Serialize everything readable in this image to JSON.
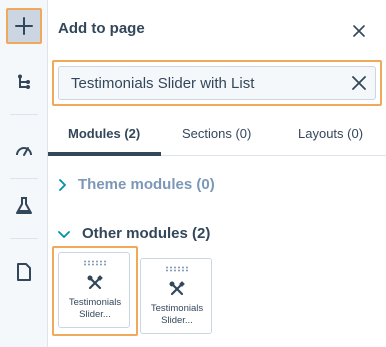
{
  "rail": {
    "icons": [
      "plus-icon",
      "tree-icon",
      "gauge-icon",
      "flask-icon",
      "document-icon"
    ]
  },
  "panel": {
    "title": "Add to page",
    "search": {
      "value": "Testimonials Slider with List"
    },
    "tabs": [
      {
        "label": "Modules (2)",
        "active": true
      },
      {
        "label": "Sections (0)",
        "active": false
      },
      {
        "label": "Layouts (0)",
        "active": false
      }
    ],
    "groups": [
      {
        "label": "Theme modules (0)",
        "expanded": false
      },
      {
        "label": "Other modules (2)",
        "expanded": true
      }
    ],
    "modules": [
      {
        "label_line1": "Testimonials",
        "label_line2": "Slider..."
      },
      {
        "label_line1": "Testimonials",
        "label_line2": "Slider..."
      }
    ]
  },
  "colors": {
    "text": "#33475b",
    "muted": "#7c98b6",
    "highlight": "#f0a85a",
    "accent": "#0091ae"
  }
}
